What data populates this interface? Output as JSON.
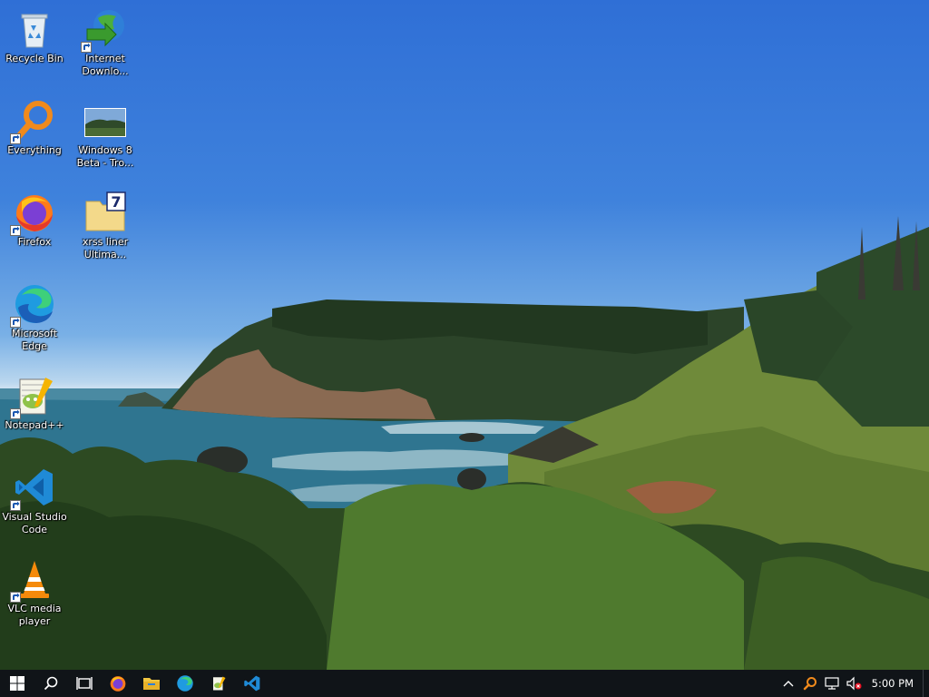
{
  "desktop": {
    "icons": [
      {
        "label": "Recycle Bin",
        "icon": "recycle-bin-icon"
      },
      {
        "label": "Internet Downlo...",
        "icon": "internet-download-manager-icon"
      },
      {
        "label": "Everything",
        "icon": "everything-search-icon"
      },
      {
        "label": "Windows 8 Beta - Tro...",
        "icon": "image-file-icon"
      },
      {
        "label": "Firefox",
        "icon": "firefox-icon"
      },
      {
        "label": "xrss liner Ultima...",
        "icon": "archive-folder-icon"
      },
      {
        "label": "Microsoft Edge",
        "icon": "edge-icon"
      },
      {
        "label": "Notepad++",
        "icon": "notepad-plus-plus-icon"
      },
      {
        "label": "Visual Studio Code",
        "icon": "vscode-icon"
      },
      {
        "label": "VLC media player",
        "icon": "vlc-icon"
      }
    ]
  },
  "taskbar": {
    "pinned": [
      "start-icon",
      "search-icon",
      "task-view-icon",
      "firefox-icon",
      "file-explorer-icon",
      "edge-icon",
      "notepad-plus-plus-icon",
      "vscode-icon"
    ],
    "tray": [
      "show-hidden-icons-chevron",
      "everything-tray-icon",
      "network-icon",
      "volume-muted-icon"
    ],
    "clock": "5:00 PM"
  },
  "colors": {
    "taskbar_bg": "#101418",
    "accent": "#76b9ed",
    "sky_top": "#2f6fd6",
    "sea": "#2f7590"
  }
}
